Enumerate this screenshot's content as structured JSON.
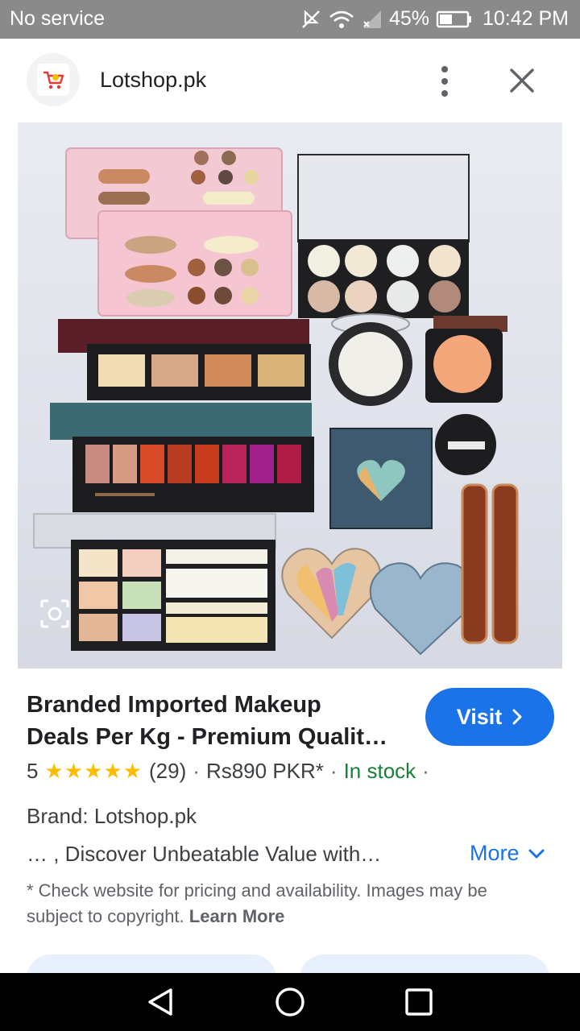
{
  "status_bar": {
    "carrier": "No service",
    "battery": "45%",
    "time": "10:42 PM"
  },
  "header": {
    "site_name": "Lotshop.pk",
    "menu_icon": "more-vert-icon",
    "close_icon": "close-icon"
  },
  "product": {
    "image_alt_icon": "lens-search-icon",
    "title_line1": "Branded Imported Makeup",
    "title_line2": "Deals Per Kg - Premium Qualit…",
    "visit_label": "Visit",
    "rating_value": "5",
    "stars": "★★★★★",
    "review_count": "(29)",
    "price": "Rs890 PKR*",
    "stock": "In stock",
    "brand": "Brand: Lotshop.pk",
    "snippet": "… , Discover Unbeatable Value with…",
    "more_label": "More",
    "disclaimer": "* Check website for pricing and availability. Images may be subject to copyright.",
    "learn_more": "Learn More"
  },
  "nav": {
    "back_icon": "back-triangle-icon",
    "home_icon": "home-circle-icon",
    "recents_icon": "recents-square-icon"
  },
  "colors": {
    "accent": "#1a73e8",
    "stars": "#fbbc04",
    "in_stock": "#188038",
    "status_bar": "#8a8a8a"
  }
}
